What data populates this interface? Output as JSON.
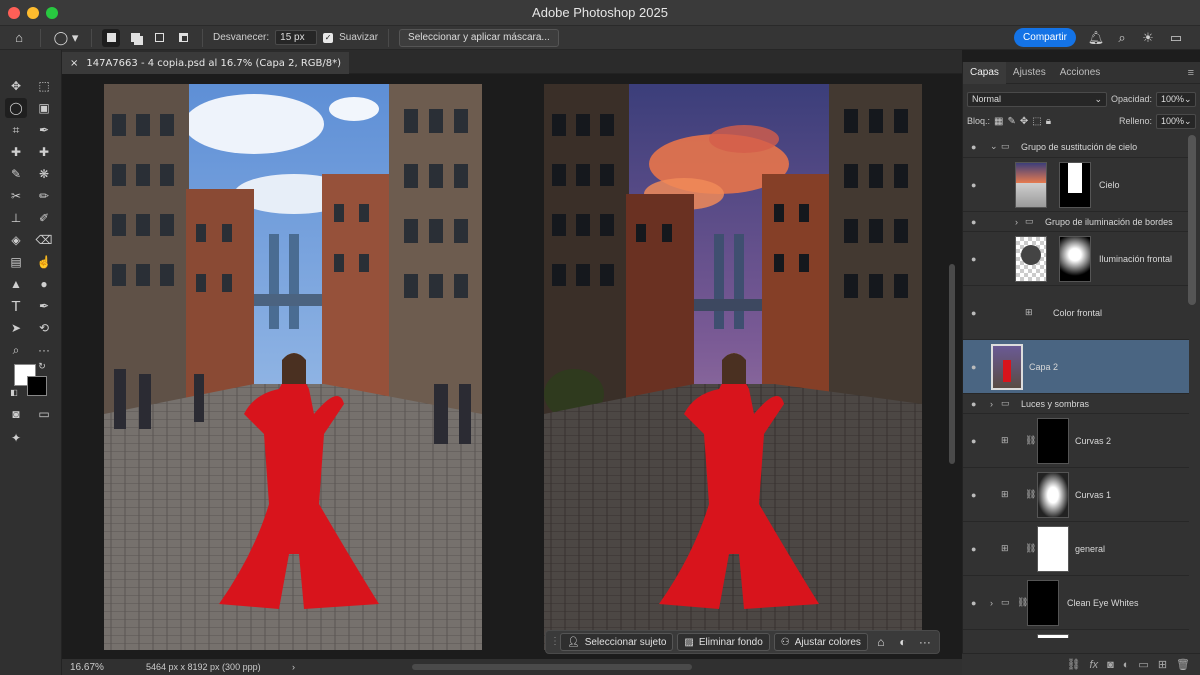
{
  "window": {
    "title": "Adobe Photoshop 2025"
  },
  "options_bar": {
    "feather_label": "Desvanecer:",
    "feather_value": "15 px",
    "smooth_label": "Suavizar",
    "select_mask_label": "Seleccionar y aplicar máscara...",
    "share_label": "Compartir"
  },
  "document": {
    "tab_title": "147A7663 - 4 copia.psd al 16.7% (Capa 2, RGB/8*)",
    "close_glyph": "×"
  },
  "status": {
    "zoom": "16.67%",
    "info": "5464 px x 8192 px (300 ppp)"
  },
  "context_bar": {
    "select_subject": "Seleccionar sujeto",
    "remove_background": "Eliminar fondo",
    "adjust_colors": "Ajustar colores"
  },
  "panel": {
    "tabs": [
      "Capas",
      "Ajustes",
      "Acciones"
    ],
    "blend_mode": "Normal",
    "opacity_label": "Opacidad:",
    "opacity_value": "100%",
    "lock_label": "Bloq.:",
    "fill_label": "Relleno:",
    "fill_value": "100%"
  },
  "layers": [
    {
      "name": "Grupo de sustitución de cielo"
    },
    {
      "name": "Cielo"
    },
    {
      "name": "Grupo de iluminación de bordes"
    },
    {
      "name": "Iluminación frontal"
    },
    {
      "name": "Color frontal"
    },
    {
      "name": "Capa 2"
    },
    {
      "name": "Luces y sombras"
    },
    {
      "name": "Curvas 2"
    },
    {
      "name": "Curvas 1"
    },
    {
      "name": "general"
    },
    {
      "name": "Clean Eye Whites"
    }
  ],
  "colors": {
    "accent": "#1473e6",
    "selected_layer": "#4a6582",
    "dress_red": "#d8141c"
  }
}
